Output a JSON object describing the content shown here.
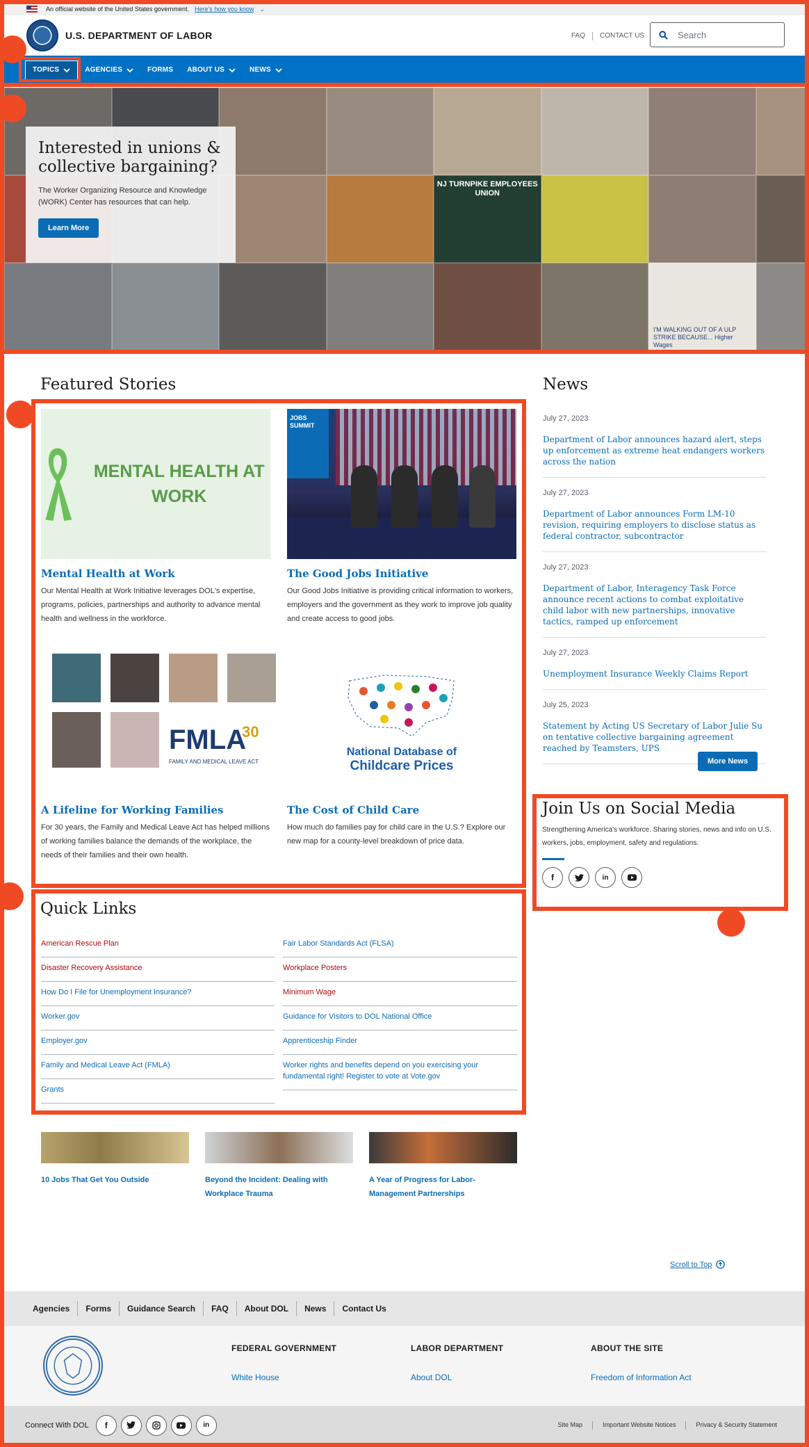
{
  "gov_banner": {
    "text": "An official website of the United States government.",
    "link": "Here’s how you know"
  },
  "header": {
    "brand": "U.S. DEPARTMENT OF LABOR",
    "faq": "FAQ",
    "contact": "CONTACT US",
    "search_placeholder": "Search"
  },
  "nav": [
    "TOPICS",
    "AGENCIES",
    "FORMS",
    "ABOUT US",
    "NEWS"
  ],
  "hero": {
    "title": "Interested in unions & collective bargaining?",
    "text": "The Worker Organizing Resource and Knowledge (WORK) Center has resources that can help.",
    "button": "Learn More",
    "sign_text_1": "NJ TURNPIKE EMPLOYEES UNION",
    "sign_text_2": "I'M WALKING OUT OF A ULP STRIKE BECAUSE... Higher Wages"
  },
  "featured": {
    "title": "Featured Stories",
    "stories": [
      {
        "img_text": "MENTAL HEALTH AT WORK",
        "title": "Mental Health at Work",
        "text": "Our Mental Health at Work Initiative leverages DOL's expertise, programs, policies, partnerships and authority to advance mental health and wellness in the workforce."
      },
      {
        "img_text": "JOBS SUMMIT",
        "title": "The Good Jobs Initiative",
        "text": "Our Good Jobs Initiative is providing critical information to workers, employers and the government as they work to improve job quality and create access to good jobs."
      },
      {
        "img_text": "FMLA",
        "img_sub": "FAMILY AND MEDICAL LEAVE ACT",
        "img_badge": "30",
        "title": "A Lifeline for Working Families",
        "text": "For 30 years, the Family and Medical Leave Act has helped millions of working families balance the demands of the workplace, the needs of their families and their own health."
      },
      {
        "img_text_1": "National Database of",
        "img_text_2": "Childcare Prices",
        "title": "The Cost of Child Care",
        "text": "How much do families pay for child care in the U.S.? Explore our new map for a county-level breakdown of price data."
      }
    ]
  },
  "news": {
    "title": "News",
    "items": [
      {
        "date": "July 27, 2023",
        "text": "Department of Labor announces hazard alert, steps up enforcement as extreme heat endangers workers across the nation"
      },
      {
        "date": "July 27, 2023",
        "text": "Department of Labor announces Form LM-10 revision, requiring employers to disclose status as federal contractor, subcontractor"
      },
      {
        "date": "July 27, 2023",
        "text": "Department of Labor, Interagency Task Force announce recent actions to combat exploitative child labor with new partnerships, innovative tactics, ramped up enforcement"
      },
      {
        "date": "July 27, 2023",
        "text": "Unemployment Insurance Weekly Claims Report"
      },
      {
        "date": "July 25, 2023",
        "text": "Statement by Acting US Secretary of Labor Julie Su on tentative collective bargaining agreement reached by Teamsters, UPS"
      }
    ],
    "more": "More News"
  },
  "social": {
    "title": "Join Us on Social Media",
    "text": "Strengthening America's workforce. Sharing stories, news and info on U.S. workers, jobs, employment, safety and regulations.",
    "icons": [
      "f",
      "t",
      "in",
      "yt"
    ]
  },
  "quick_links": {
    "title": "Quick Links",
    "left": [
      "American Rescue Plan",
      "Disaster Recovery Assistance",
      "How Do I File for Unemployment Insurance?",
      "Worker.gov",
      "Employer.gov",
      "Family and Medical Leave Act (FMLA)",
      "Grants"
    ],
    "right": [
      "Fair Labor Standards Act (FLSA)",
      "Workplace Posters",
      "Minimum Wage",
      "Guidance for Visitors to DOL National Office",
      "Apprenticeship Finder",
      "Worker rights and benefits depend on you exercising your fundamental right! Register to vote at Vote.gov"
    ]
  },
  "promos": [
    "10 Jobs That Get You Outside",
    "Beyond the Incident: Dealing with Workplace Trauma",
    "A Year of Progress for Labor-Management Partnerships"
  ],
  "scroll_top": "Scroll to Top",
  "footer": {
    "nav": [
      "Agencies",
      "Forms",
      "Guidance Search",
      "FAQ",
      "About DOL",
      "News",
      "Contact Us"
    ],
    "columns": [
      {
        "title": "FEDERAL GOVERNMENT",
        "link": "White House"
      },
      {
        "title": "LABOR DEPARTMENT",
        "link": "About DOL"
      },
      {
        "title": "ABOUT THE SITE",
        "link": "Freedom of Information Act"
      }
    ],
    "connect": "Connect With DOL",
    "small": [
      "Site Map",
      "Important Website Notices",
      "Privacy & Security Statement"
    ]
  },
  "colors": {
    "accent": "#0071c5",
    "link": "#0b6cb5",
    "highlight": "#f04a24",
    "quick_link_red": "#b50909"
  }
}
